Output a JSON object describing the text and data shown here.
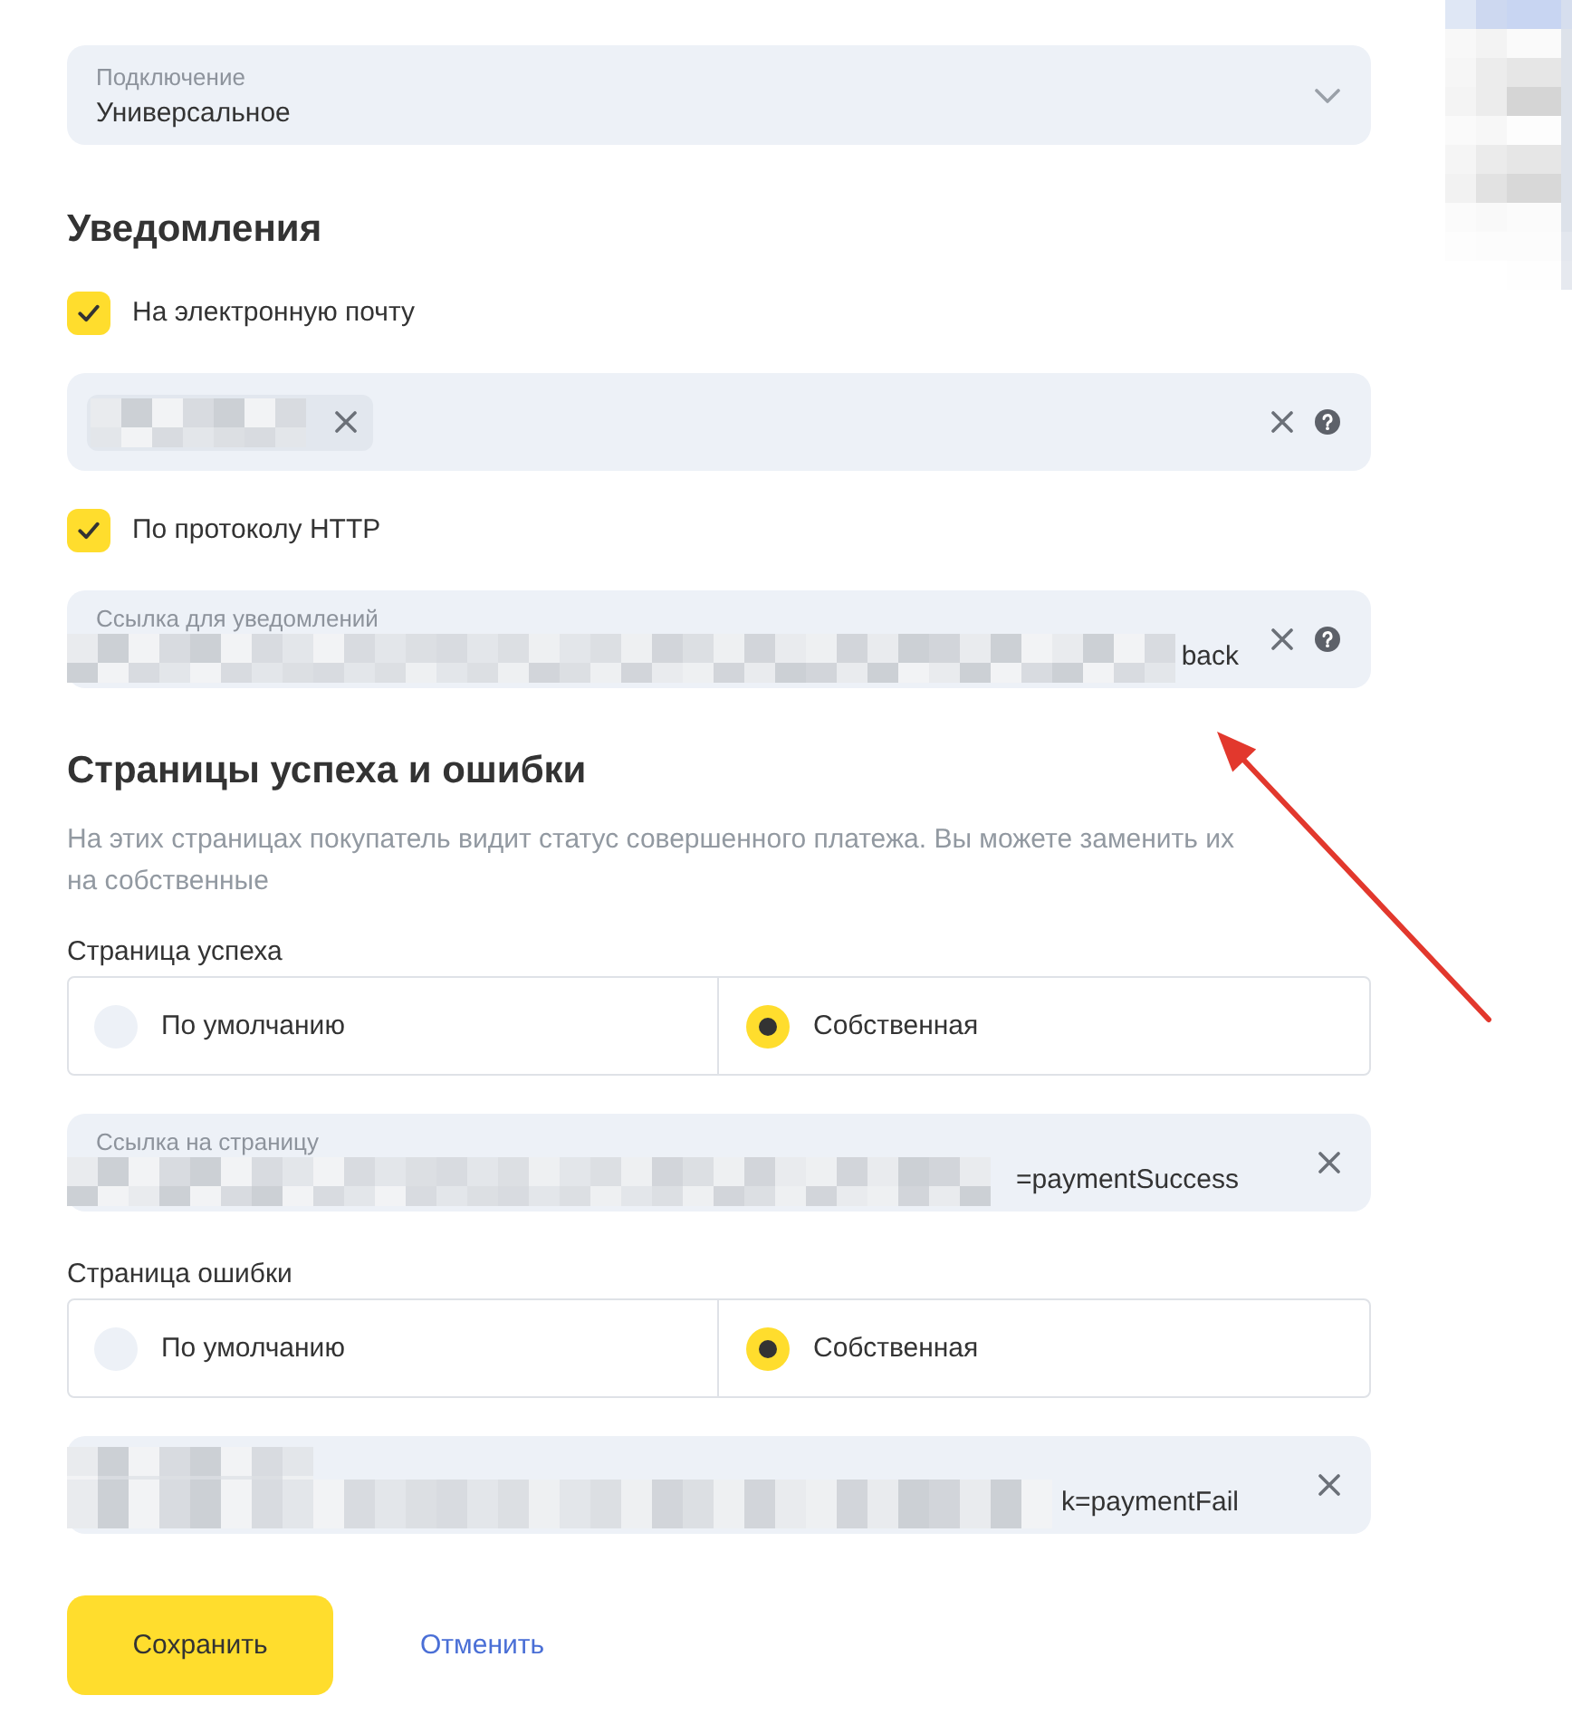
{
  "connection": {
    "label": "Подключение",
    "value": "Универсальное"
  },
  "notifications": {
    "title": "Уведомления",
    "channels": [
      {
        "label": "На электронную почту",
        "checked": true,
        "field": {
          "chips": [
            {
              "redacted": true
            }
          ],
          "clearable": true,
          "help": true
        }
      },
      {
        "label": "По протоколу HTTP",
        "checked": true,
        "field": {
          "label": "Ссылка для уведомлений",
          "redacted": true,
          "value": "back",
          "clearable": true,
          "help": true
        }
      }
    ]
  },
  "result_pages": {
    "title": "Страницы успеха и ошибки",
    "description": "На этих страницах покупатель видит статус совершенного платежа. Вы можете заменить их на собственные",
    "groups": [
      {
        "label": "Страница успеха",
        "options": [
          {
            "label": "По умолчанию",
            "selected": false
          },
          {
            "label": "Собственная",
            "selected": true
          }
        ],
        "field": {
          "label": "Ссылка на страницу",
          "redacted": true,
          "value": "=paymentSuccess",
          "clearable": true
        }
      },
      {
        "label": "Страница ошибки",
        "options": [
          {
            "label": "По умолчанию",
            "selected": false
          },
          {
            "label": "Собственная",
            "selected": true
          }
        ],
        "field": {
          "label_redacted": true,
          "redacted": true,
          "value": "k=paymentFail",
          "clearable": true
        }
      }
    ]
  },
  "actions": [
    {
      "kind": "primary",
      "label": "Сохранить"
    },
    {
      "kind": "link",
      "label": "Отменить"
    }
  ],
  "annotations": [
    {
      "kind": "arrow"
    }
  ],
  "redactions": [
    {
      "kind": "side_block"
    }
  ]
}
